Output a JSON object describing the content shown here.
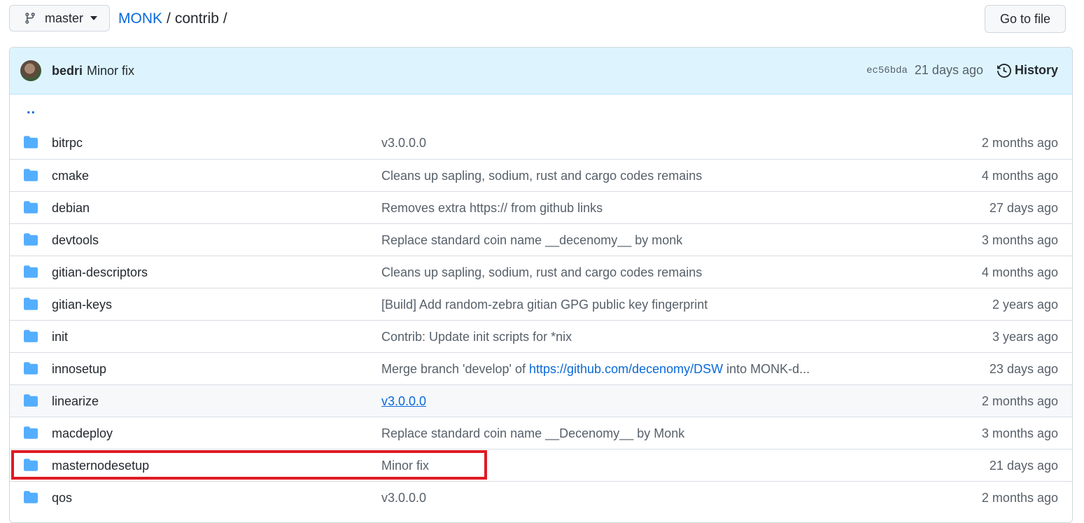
{
  "topbar": {
    "branch": "master",
    "breadcrumb": {
      "repo": "MONK",
      "sep1": "/",
      "dir": "contrib",
      "sep2": "/"
    },
    "go_to_file": "Go to file"
  },
  "latest_commit": {
    "author": "bedri",
    "message": "Minor fix",
    "sha": "ec56bda",
    "age": "21 days ago",
    "history_label": "History"
  },
  "parent_dir": "..",
  "files": [
    {
      "name": "bitrpc",
      "message": "v3.0.0.0",
      "age": "2 months ago"
    },
    {
      "name": "cmake",
      "message": "Cleans up sapling, sodium, rust and cargo codes remains",
      "age": "4 months ago"
    },
    {
      "name": "debian",
      "message": "Removes extra https:// from github links",
      "age": "27 days ago"
    },
    {
      "name": "devtools",
      "message": "Replace standard coin name __decenomy__ by monk",
      "age": "3 months ago"
    },
    {
      "name": "gitian-descriptors",
      "message": "Cleans up sapling, sodium, rust and cargo codes remains",
      "age": "4 months ago"
    },
    {
      "name": "gitian-keys",
      "message": "[Build] Add random-zebra gitian GPG public key fingerprint",
      "age": "2 years ago"
    },
    {
      "name": "init",
      "message": "Contrib: Update init scripts for *nix",
      "age": "3 years ago"
    },
    {
      "name": "innosetup",
      "message_prefix": "Merge branch 'develop' of ",
      "message_link": "https://github.com/decenomy/DSW",
      "message_suffix": " into MONK-d...",
      "age": "23 days ago"
    },
    {
      "name": "linearize",
      "message": "v3.0.0.0",
      "age": "2 months ago"
    },
    {
      "name": "macdeploy",
      "message": "Replace standard coin name __Decenomy__ by Monk",
      "age": "3 months ago"
    },
    {
      "name": "masternodesetup",
      "message": "Minor fix",
      "age": "21 days ago"
    },
    {
      "name": "qos",
      "message": "v3.0.0.0",
      "age": "2 months ago"
    }
  ],
  "colors": {
    "link": "#0969da",
    "folder": "#54aeff",
    "highlight": "#e01b24",
    "commit_bar": "#ddf4ff"
  }
}
